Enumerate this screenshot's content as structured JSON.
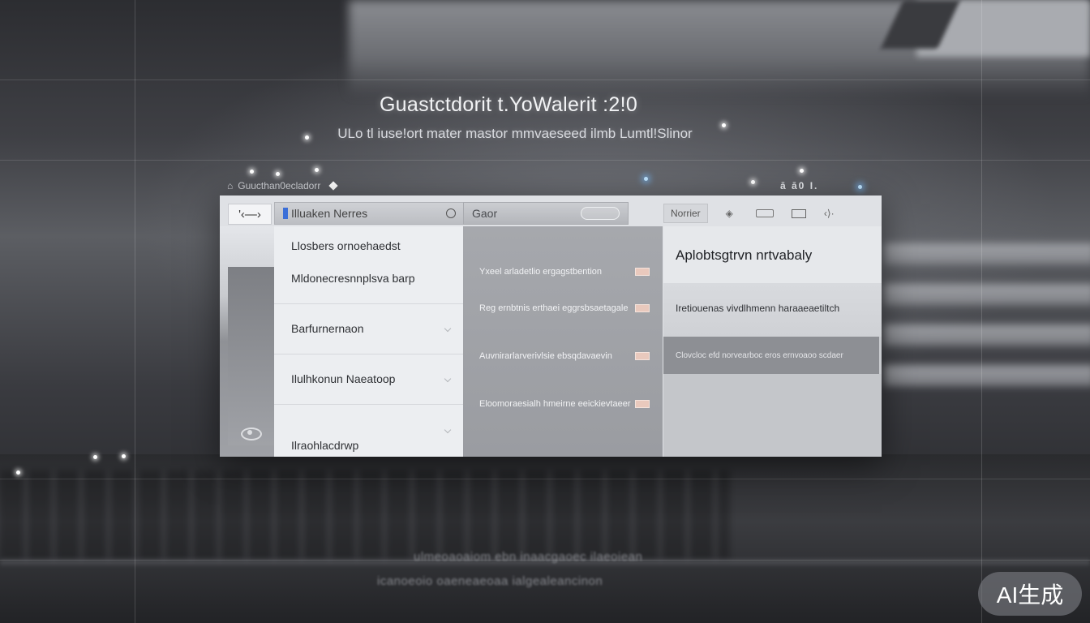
{
  "headline": {
    "title": "Guastctdorit t.YoWalerit :2!0",
    "subtitle": "ULo tl iuse!ort mater mastor mmvaeseed ilmb Lumtl!Slinor"
  },
  "top_caption": {
    "text": "Guucthan0ecladorr",
    "right_marks": "ā  ā0 I."
  },
  "window": {
    "back_button_label": "'‹—›",
    "header": {
      "left_label": "Illuaken Nerres",
      "mid_label": "Gaor",
      "right_label": "Norrier",
      "right_icons": [
        "diamond-icon",
        "tag-icon",
        "box-icon",
        "back-forward-icon"
      ]
    },
    "list_items": [
      "Llosbers ornoehaedst",
      "Mldonecresnnplsva barp",
      "Barfurnernaon",
      "Ilulhkonun Naeatoop",
      "Ilraohlacdrwp"
    ],
    "middle_rows": [
      "Yxeel arladetlio ergagstbention",
      "Reg ernbtnis erthaei eggrsbsaetagale",
      "Auvnirarlarverivlsie ebsqdavaevin",
      "Eloomoraesialh hmeirne eeickievtaeer"
    ],
    "right_panel": {
      "title": "Aplobtsgtrvn nrtvabaly",
      "description": "Iretiouenas vivdlhmenn haraaeaetiltch",
      "selected_row": "Clovcloc efd norvearboc eros ernvoaoo scdaer"
    }
  },
  "background_text": [
    "ulmeoaoaiom ebn inaacgaoec ilaeoiean",
    "icanoeoio oaeneaeoaa ialgealeancinon"
  ],
  "watermark": "AI生成",
  "colors": {
    "accent_blue": "#3b6fd8",
    "swatch_peach": "#e9c9bd",
    "selected_row": "#8d8f94"
  }
}
